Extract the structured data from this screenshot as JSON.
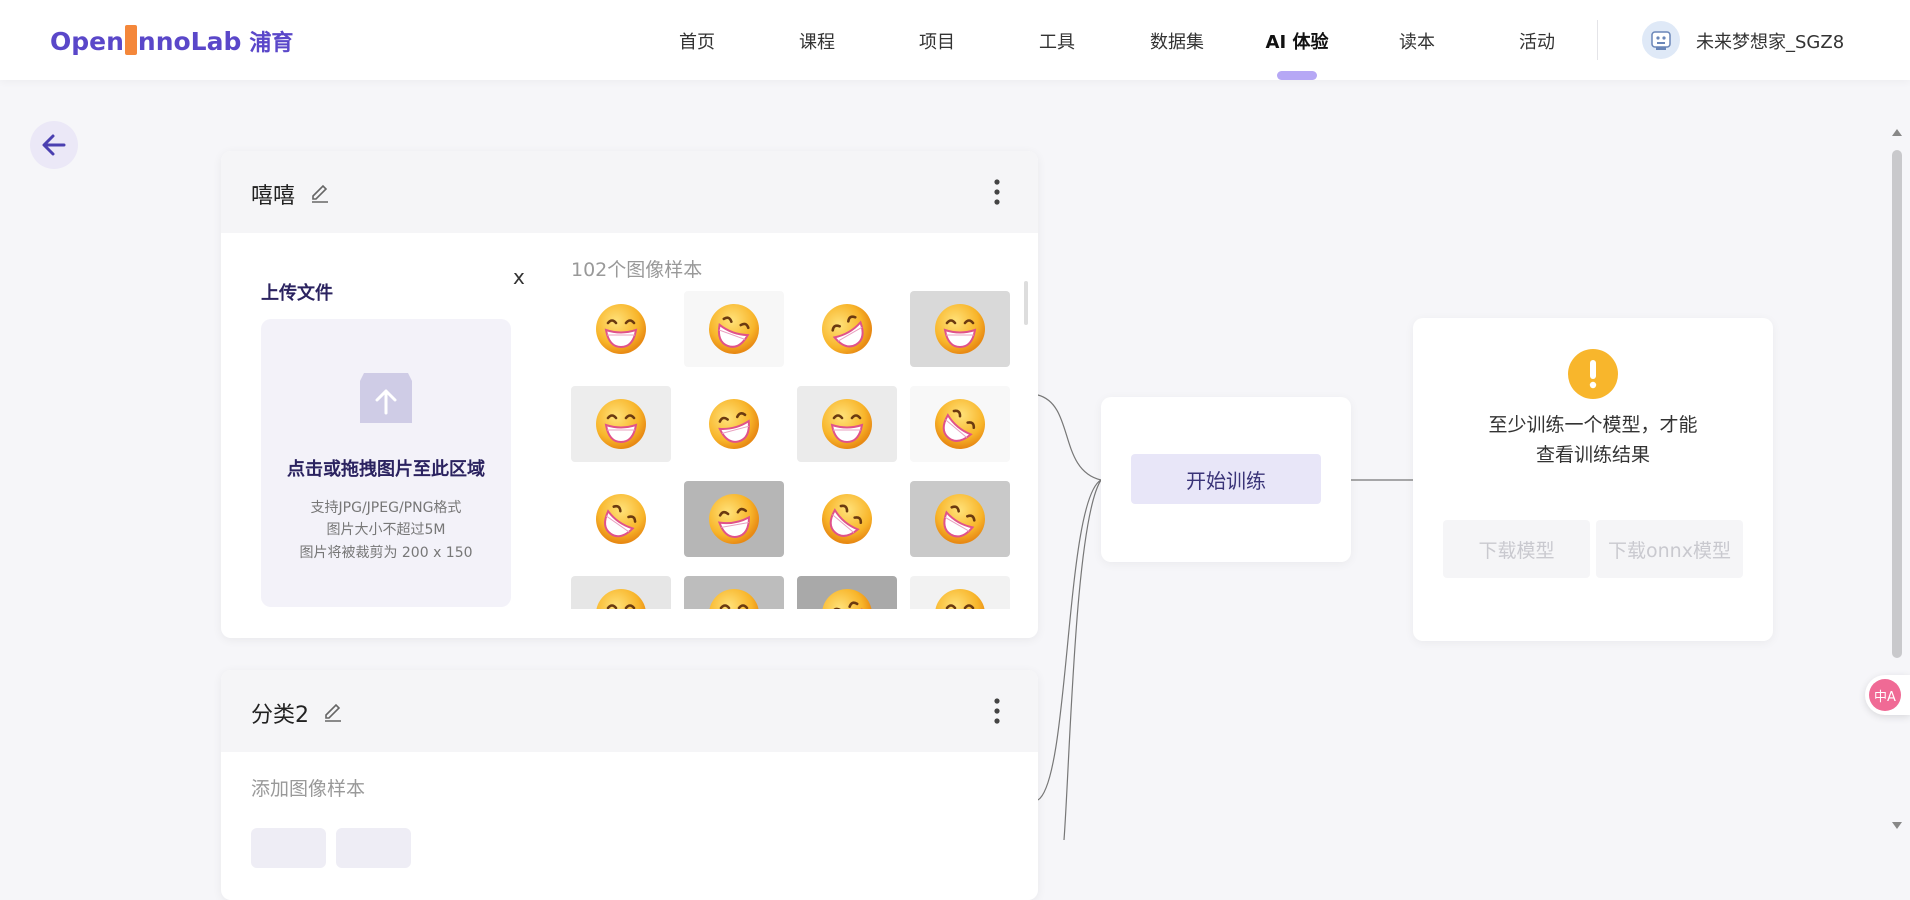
{
  "header": {
    "logo": {
      "part1": "Open",
      "part2": "nnoLab",
      "cn": "浦育"
    },
    "nav": [
      {
        "label": "首页",
        "active": false
      },
      {
        "label": "课程",
        "active": false
      },
      {
        "label": "项目",
        "active": false
      },
      {
        "label": "工具",
        "active": false
      },
      {
        "label": "数据集",
        "active": false
      },
      {
        "label": "AI 体验",
        "active": true
      },
      {
        "label": "读本",
        "active": false
      },
      {
        "label": "活动",
        "active": false
      }
    ],
    "username": "未来梦想家_SGZ8"
  },
  "classes": [
    {
      "title": "嘻嘻",
      "upload": {
        "title": "上传文件",
        "close": "x",
        "drop_text": "点击或拖拽图片至此区域",
        "hint1": "支持JPG/JPEG/PNG格式",
        "hint2": "图片大小不超过5M",
        "hint3": "图片将被裁剪为 200 x 150"
      },
      "sample_count": "102个图像样本",
      "thumb_backgrounds": [
        "#ffffff",
        "#f7f7f7",
        "#ffffff",
        "#d9d9d9",
        "#ededed",
        "#ffffff",
        "#ebebeb",
        "#f8f8f8",
        "#ffffff",
        "#b6b6b6",
        "#ffffff",
        "#c9c9c9",
        "#e6e6e6",
        "#bdbdbd",
        "#a9a9a9",
        "#f2f2f2"
      ]
    },
    {
      "title": "分类2",
      "placeholder": "添加图像样本"
    }
  ],
  "train": {
    "button": "开始训练"
  },
  "result": {
    "line1": "至少训练一个模型，才能",
    "line2": "查看训练结果",
    "download_model": "下载模型",
    "download_onnx": "下载onnx模型"
  },
  "translate_fab": "中A",
  "colors": {
    "brand": "#5a47c9",
    "warning": "#f8b62c",
    "logo_accent": "#f4873a"
  }
}
